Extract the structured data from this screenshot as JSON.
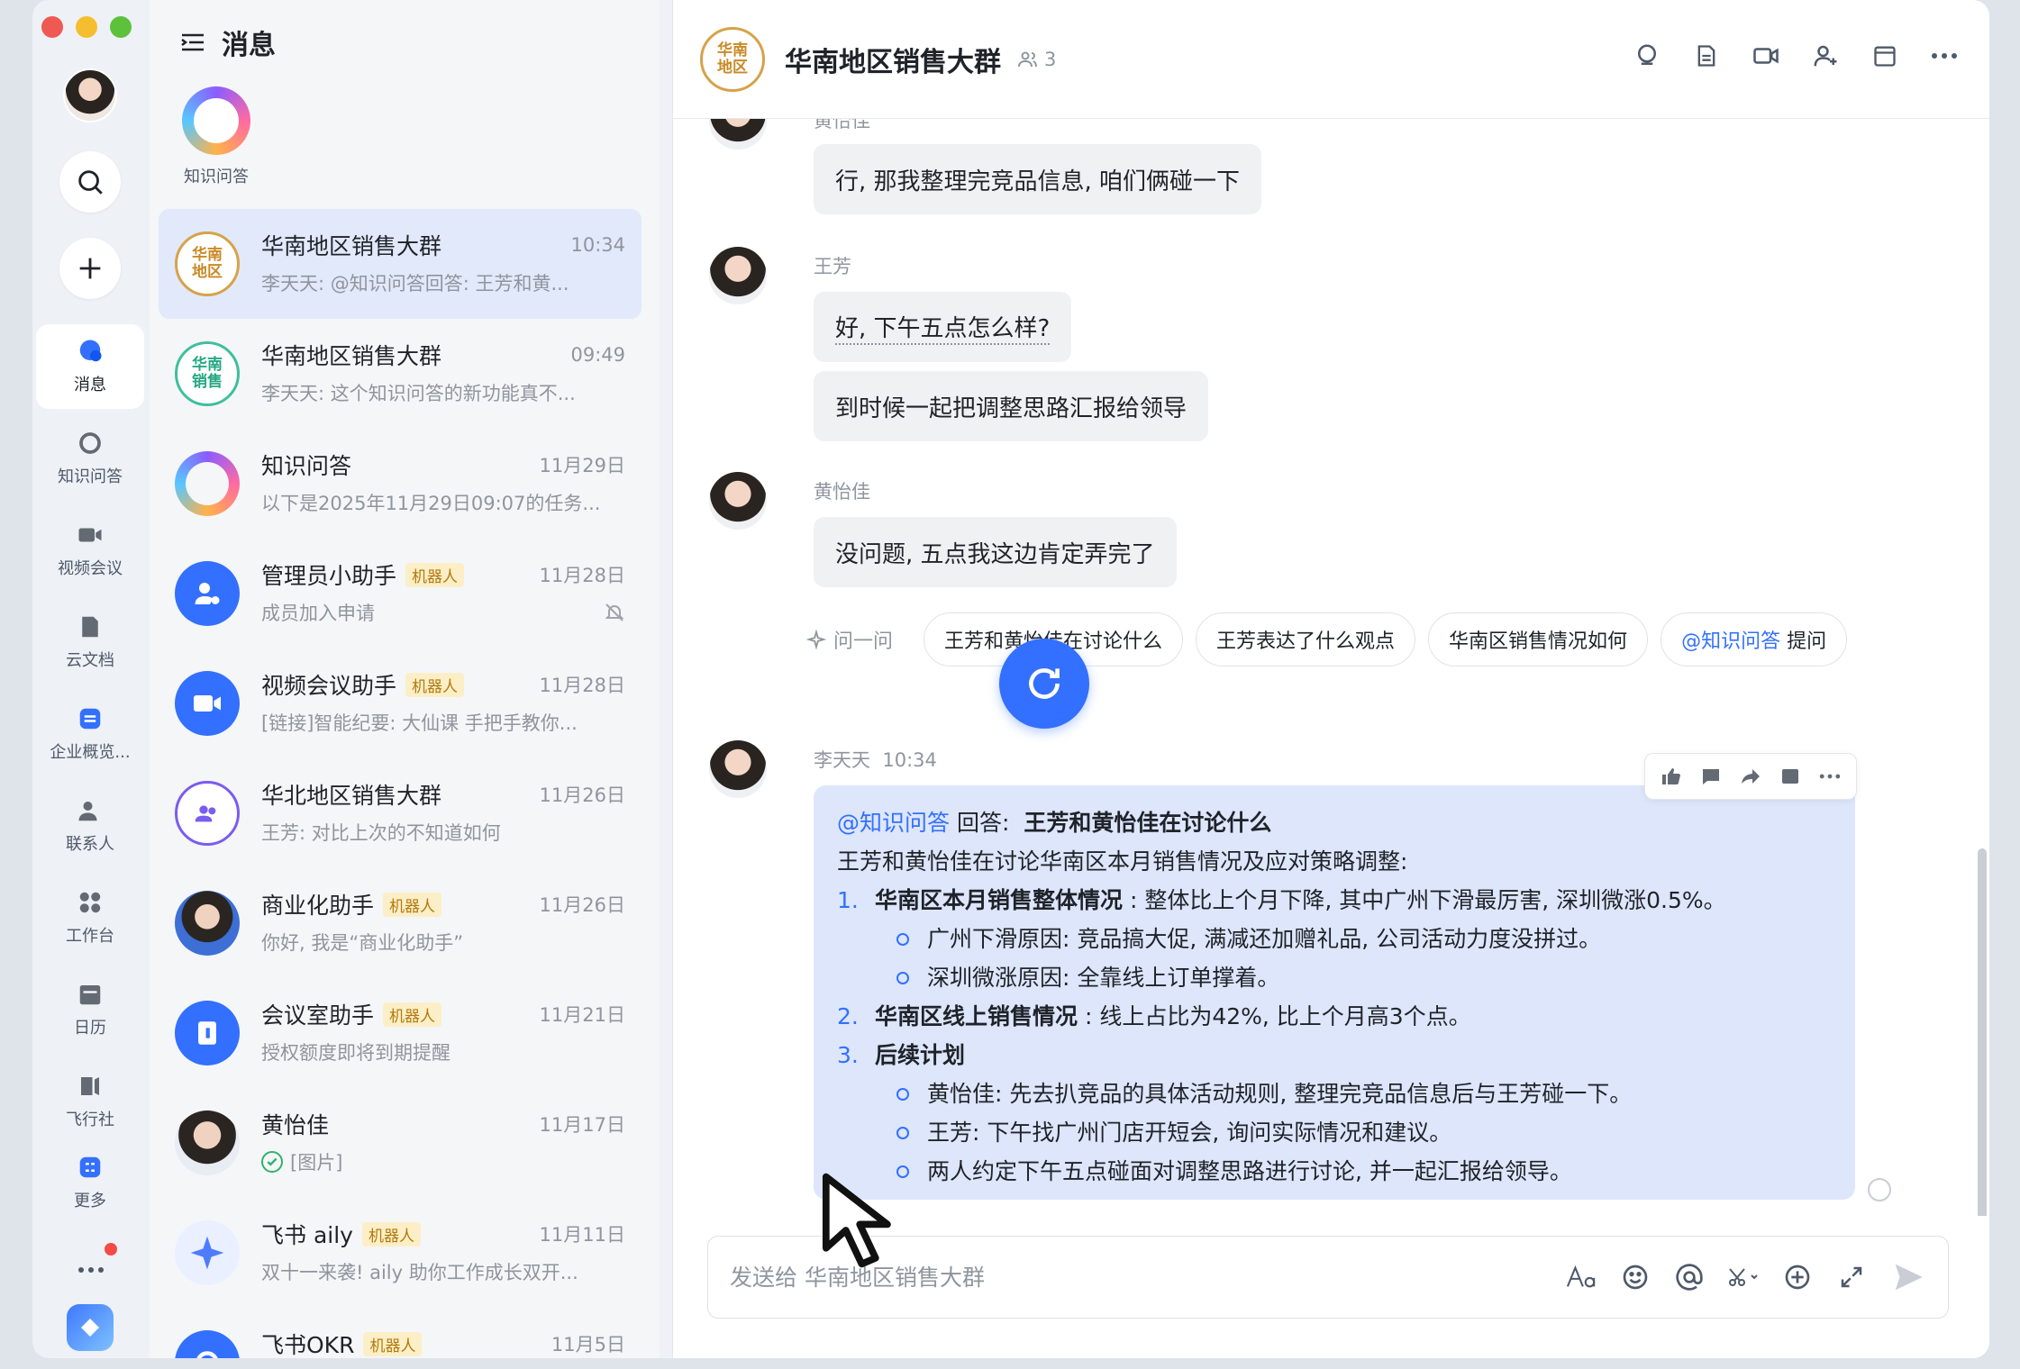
{
  "window": {
    "title": "消息"
  },
  "rail": {
    "items": [
      {
        "label": "消息",
        "icon": "chat-bubble-icon",
        "active": true
      },
      {
        "label": "知识问答",
        "icon": "ai-ring-icon"
      },
      {
        "label": "视频会议",
        "icon": "video-camera-icon"
      },
      {
        "label": "云文档",
        "icon": "cloud-doc-icon"
      },
      {
        "label": "企业概览...",
        "icon": "enterprise-icon"
      },
      {
        "label": "联系人",
        "icon": "contacts-icon"
      },
      {
        "label": "工作台",
        "icon": "workbench-icon"
      },
      {
        "label": "日历",
        "icon": "calendar-icon"
      },
      {
        "label": "飞行社",
        "icon": "flyer-icon"
      },
      {
        "label": "更多",
        "icon": "more-apps-icon"
      }
    ]
  },
  "list": {
    "title": "消息",
    "pinned_label": "知识问答",
    "conversations": [
      {
        "name": "华南地区销售大群",
        "avatar_text": "华南\n地区",
        "time": "10:34",
        "preview": "李天天: @知识问答回答: 王芳和黄...",
        "bot": false
      },
      {
        "name": "华南地区销售大群",
        "avatar_text": "华南\n销售",
        "time": "09:49",
        "preview": "李天天: 这个知识问答的新功能真不...",
        "bot": false
      },
      {
        "name": "知识问答",
        "avatar_text": "",
        "time": "11月29日",
        "preview": "以下是2025年11月29日09:07的任务...",
        "bot": false
      },
      {
        "name": "管理员小助手",
        "avatar_text": "",
        "time": "11月28日",
        "preview": "成员加入申请",
        "bot": true
      },
      {
        "name": "视频会议助手",
        "avatar_text": "",
        "time": "11月28日",
        "preview": "[链接]智能纪要: 大仙课 手把手教你...",
        "bot": true
      },
      {
        "name": "华北地区销售大群",
        "avatar_text": "",
        "time": "11月26日",
        "preview": "王芳: 对比上次的不知道如何",
        "bot": false
      },
      {
        "name": "商业化助手",
        "avatar_text": "",
        "time": "11月26日",
        "preview": "你好, 我是“商业化助手”",
        "bot": true
      },
      {
        "name": "会议室助手",
        "avatar_text": "",
        "time": "11月21日",
        "preview": "授权额度即将到期提醒",
        "bot": true
      },
      {
        "name": "黄怡佳",
        "avatar_text": "",
        "time": "11月17日",
        "preview": "[图片]",
        "bot": false
      },
      {
        "name": "飞书 aily",
        "avatar_text": "",
        "time": "11月11日",
        "preview": "双十一来袭! aily 助你工作成长双开...",
        "bot": true
      },
      {
        "name": "飞书OKR",
        "avatar_text": "",
        "time": "11月5日",
        "preview": "",
        "bot": true
      }
    ],
    "bot_tag": "机器人"
  },
  "chat": {
    "avatar_text": "华南\n地区",
    "title": "华南地区销售大群",
    "member_count": "3",
    "messages": [
      {
        "sender": "黄怡佳",
        "bubbles": [
          "行, 那我整理完竞品信息, 咱们俩碰一下"
        ]
      },
      {
        "sender": "王芳",
        "bubbles": [
          "好, 下午五点怎么样?",
          "到时候一起把调整思路汇报给领导"
        ]
      },
      {
        "sender": "黄怡佳",
        "bubbles": [
          "没问题, 五点我这边肯定弄完了"
        ]
      }
    ],
    "ask_label": "问一问",
    "suggestions": [
      "王芳和黄怡佳在讨论什么",
      "王芳表达了什么观点",
      "华南区销售情况如何"
    ],
    "ask_mention": "@知识问答",
    "ask_suffix": "提问",
    "answer": {
      "sender": "李天天",
      "time": "10:34",
      "mention": "@知识问答",
      "reply_label": "回答:",
      "question": "王芳和黄怡佳在讨论什么",
      "intro": "王芳和黄怡佳在讨论华南区本月销售情况及应对策略调整:",
      "items": [
        {
          "num": "1.",
          "title": "华南区本月销售整体情况",
          "text": ": 整体比上个月下降, 其中广州下滑最厉害, 深圳微涨0.5%。",
          "subs": [
            "广州下滑原因: 竞品搞大促, 满减还加赠礼品, 公司活动力度没拼过。",
            "深圳微涨原因: 全靠线上订单撑着。"
          ]
        },
        {
          "num": "2.",
          "title": "华南区线上销售情况",
          "text": ": 线上占比为42%, 比上个月高3个点。",
          "subs": []
        },
        {
          "num": "3.",
          "title": "后续计划",
          "text": "",
          "subs": [
            "黄怡佳: 先去扒竞品的具体活动规则, 整理完竞品信息后与王芳碰一下。",
            "王芳: 下午找广州门店开短会, 询问实际情况和建议。",
            "两人约定下午五点碰面对调整思路进行讨论, 并一起汇报给领导。"
          ]
        }
      ]
    },
    "composer_placeholder": "发送给 华南地区销售大群"
  },
  "colors": {
    "accent": "#3370ff",
    "active_bg": "#e1e9fb",
    "answer_bg": "#dde6fb"
  }
}
